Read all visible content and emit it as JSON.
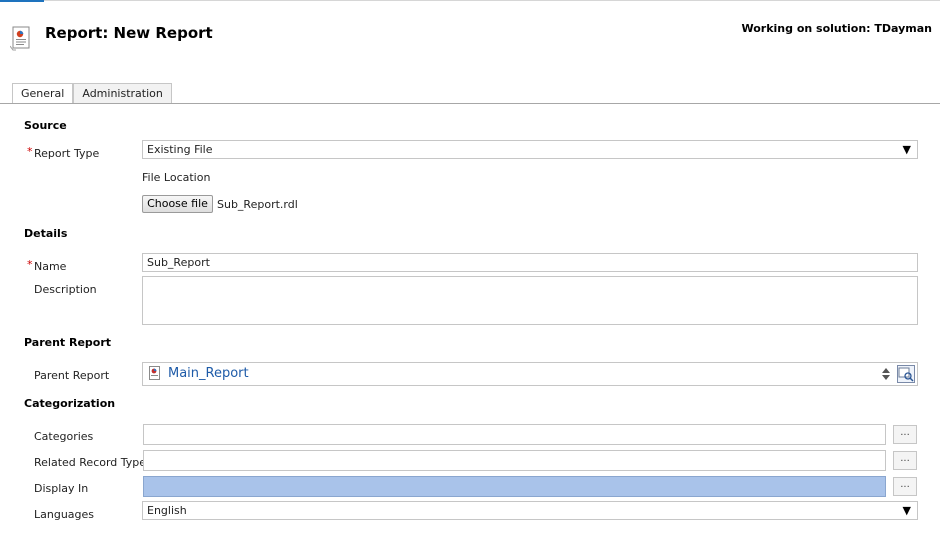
{
  "header": {
    "title": "Report: New Report",
    "solution": "Working on solution: TDayman",
    "icon": "report-icon"
  },
  "tabs": [
    {
      "label": "General",
      "active": true
    },
    {
      "label": "Administration",
      "active": false
    }
  ],
  "source": {
    "heading": "Source",
    "report_type_label": "Report Type",
    "report_type_value": "Existing File",
    "file_location_label": "File Location",
    "choose_file_label": "Choose file",
    "file_name": "Sub_Report.rdl"
  },
  "details": {
    "heading": "Details",
    "name_label": "Name",
    "name_value": "Sub_Report",
    "description_label": "Description",
    "description_value": ""
  },
  "parent": {
    "heading": "Parent Report",
    "label": "Parent Report",
    "value": "Main_Report"
  },
  "categorization": {
    "heading": "Categorization",
    "categories_label": "Categories",
    "categories_value": "",
    "related_label": "Related Record Types",
    "related_value": "",
    "display_in_label": "Display In",
    "display_in_value": "",
    "languages_label": "Languages",
    "languages_value": "English",
    "ellipsis": "..."
  },
  "required_marker": "*",
  "dropdown_caret": "▼",
  "colors": {
    "accent": "#1e73be",
    "required": "#cc0000",
    "link": "#1e5ba8",
    "selected_field": "#a9c3ea"
  }
}
